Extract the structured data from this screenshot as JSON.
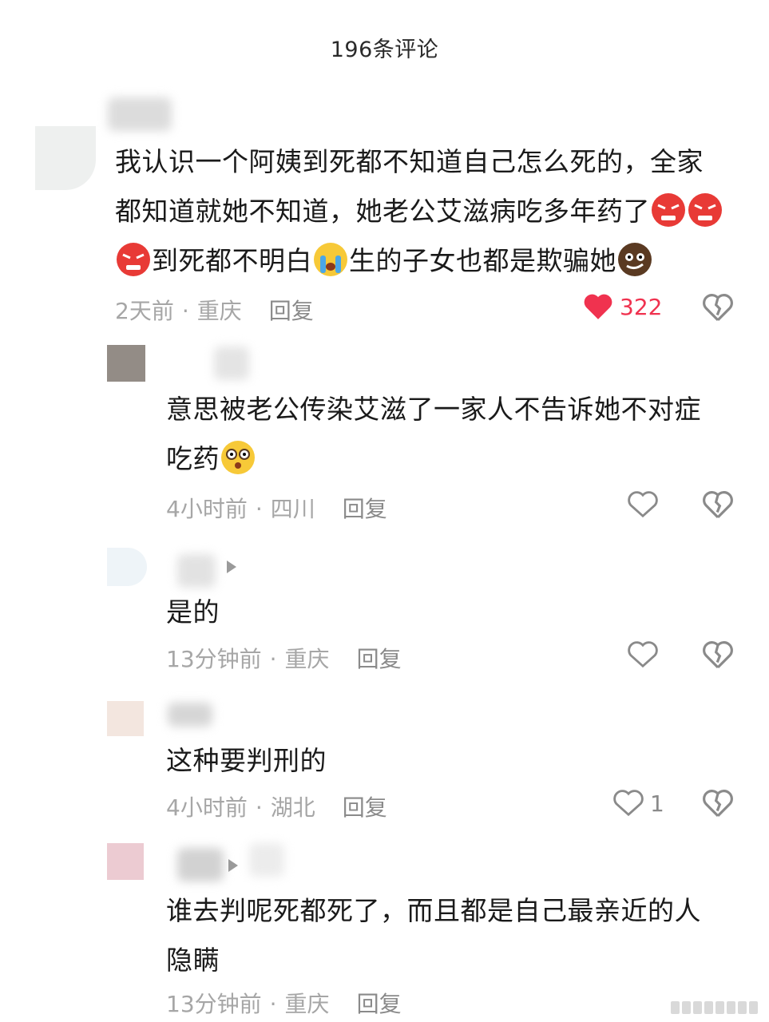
{
  "header": {
    "title": "196条评论"
  },
  "comments": [
    {
      "text": "我认识一个阿姨到死都不知道自己怎么死的，全家都知道就她不知道，她老公艾滋病吃多年药了",
      "text2": "到死都不明白",
      "text3": "生的子女也都是欺骗她",
      "time": "2天前",
      "location": "重庆",
      "reply": "回复",
      "likes": "322",
      "liked": true
    },
    {
      "text": "意思被老公传染艾滋了一家人不告诉她不对症吃药",
      "time": "4小时前",
      "location": "四川",
      "reply": "回复",
      "likes": "",
      "liked": false
    },
    {
      "text": "是的",
      "time": "13分钟前",
      "location": "重庆",
      "reply": "回复",
      "likes": "",
      "liked": false
    },
    {
      "text": "这种要判刑的",
      "time": "4小时前",
      "location": "湖北",
      "reply": "回复",
      "likes": "1",
      "liked": false
    },
    {
      "text": "谁去判呢死都死了，而且都是自己最亲近的人隐瞒",
      "time": "13分钟前",
      "location": "重庆",
      "reply": "回复",
      "likes": "",
      "liked": false
    }
  ],
  "icons": {
    "like": "heart-icon",
    "dislike": "broken-heart-icon",
    "angry_emoji": "angry-face-emoji",
    "crying_emoji": "crying-face-emoji",
    "dizzy_emoji": "dizzy-face-emoji",
    "smirk_emoji": "sly-face-emoji"
  },
  "colors": {
    "liked_heart": "#f0324f",
    "meta_gray": "#a6a6a6",
    "body_text": "#1a1a1a"
  }
}
